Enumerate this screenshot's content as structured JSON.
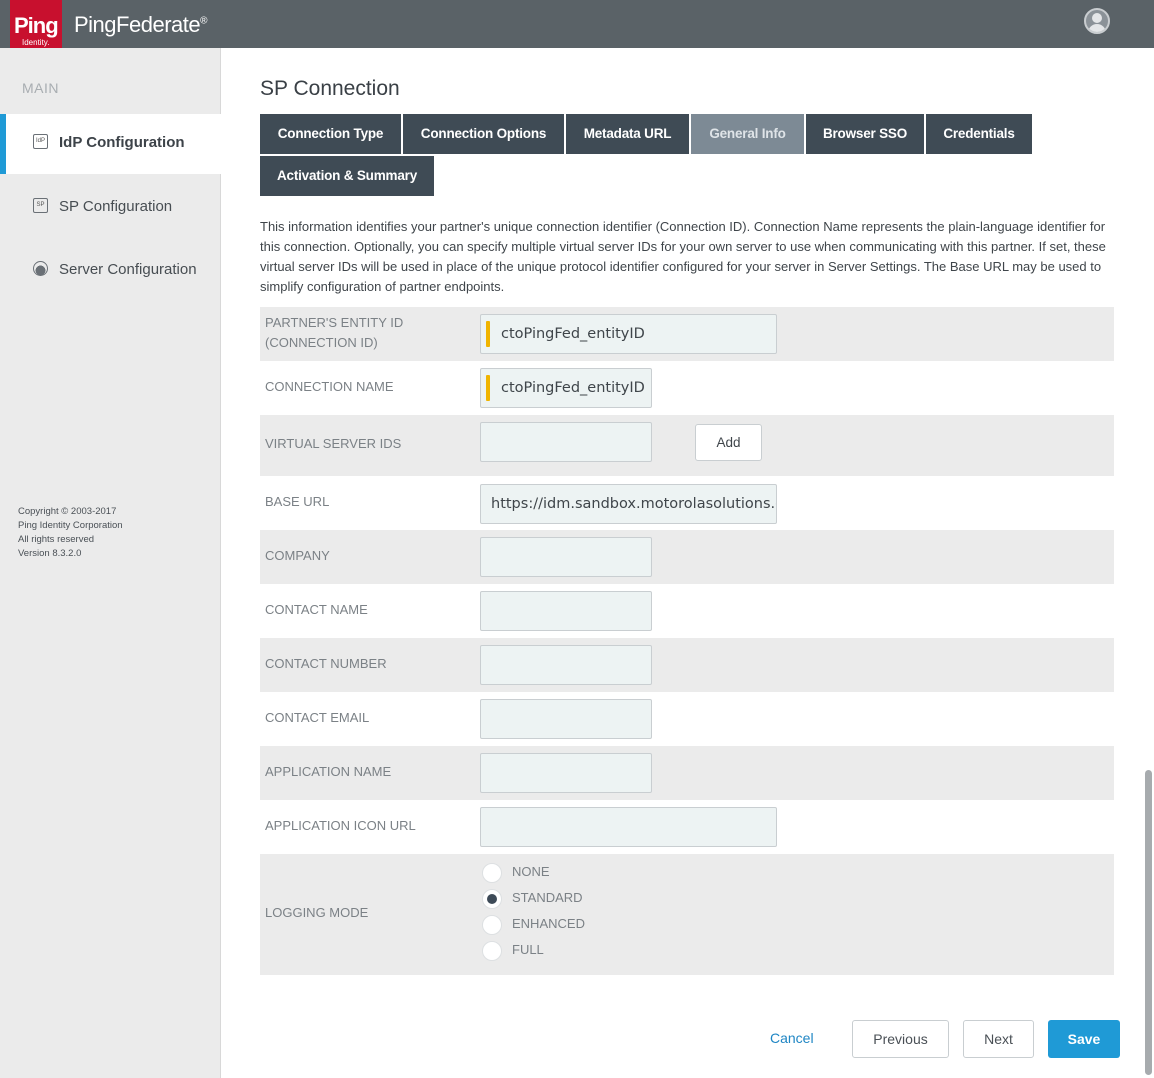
{
  "header": {
    "logo_text": "Ping",
    "logo_subtext": "Identity.",
    "product_name_part1": "Ping",
    "product_name_part2": "Federate",
    "product_mark": "®"
  },
  "sidebar": {
    "section_label": "MAIN",
    "items": [
      {
        "label": "IdP Configuration",
        "icon": "idp-icon",
        "icon_text": "IdP"
      },
      {
        "label": "SP Configuration",
        "icon": "sp-icon",
        "icon_text": "SP"
      },
      {
        "label": "Server Configuration",
        "icon": "server-icon",
        "icon_text": ""
      }
    ],
    "copyright": {
      "line1": "Copyright © 2003-2017",
      "line2": "Ping Identity Corporation",
      "line3": "All rights reserved",
      "line4": "Version 8.3.2.0"
    }
  },
  "main": {
    "title": "SP Connection",
    "tabs": [
      {
        "label": "Connection Type"
      },
      {
        "label": "Connection Options"
      },
      {
        "label": "Metadata URL"
      },
      {
        "label": "General Info"
      },
      {
        "label": "Browser SSO"
      },
      {
        "label": "Credentials"
      },
      {
        "label": "Activation & Summary"
      }
    ],
    "active_tab": "General Info",
    "intro": "This information identifies your partner's unique connection identifier (Connection ID). Connection Name represents the plain-language identifier for this connection. Optionally, you can specify multiple virtual server IDs for your own server to use when communicating with this partner. If set, these virtual server IDs will be used in place of the unique protocol identifier configured for your server in Server Settings. The Base URL may be used to simplify configuration of partner endpoints."
  },
  "form": {
    "entity_id_label_line1": "Partner's Entity ID",
    "entity_id_label_line2": "(Connection ID)",
    "entity_id_value": "ctoPingFed_entityID",
    "connection_name_label": "Connection Name",
    "connection_name_value": "ctoPingFed_entityID",
    "virtual_server_ids_label": "Virtual Server IDs",
    "virtual_server_ids_value": "",
    "add_button_label": "Add",
    "base_url_label": "Base URL",
    "base_url_value": "https://idm.sandbox.motorolasolutions.co",
    "company_label": "Company",
    "company_value": "",
    "contact_name_label": "Contact Name",
    "contact_name_value": "",
    "contact_number_label": "Contact Number",
    "contact_number_value": "",
    "contact_email_label": "Contact Email",
    "contact_email_value": "",
    "application_name_label": "Application Name",
    "application_name_value": "",
    "application_icon_url_label": "Application Icon URL",
    "application_icon_url_value": "",
    "logging_mode_label": "Logging Mode",
    "logging_options": [
      "NONE",
      "STANDARD",
      "ENHANCED",
      "FULL"
    ],
    "logging_selected": "STANDARD"
  },
  "footer": {
    "cancel_label": "Cancel",
    "previous_label": "Previous",
    "next_label": "Next",
    "save_label": "Save"
  },
  "colors": {
    "header_bg": "#5a6267",
    "brand_red": "#c8102e",
    "tab_bg": "#3f4b55",
    "tab_active_bg": "#7d8a95",
    "accent_blue": "#1f9ad6",
    "required_marker": "#f0b400"
  }
}
